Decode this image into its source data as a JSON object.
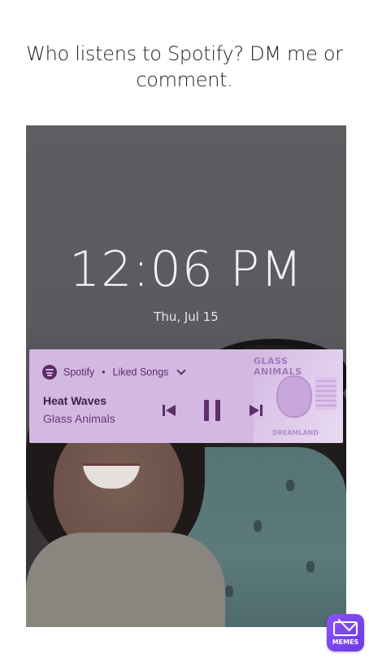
{
  "post": {
    "caption": "Who listens to Spotify?  DM me or comment."
  },
  "lockscreen": {
    "time": "12:06 PM",
    "date": "Thu, Jul 15"
  },
  "media_notification": {
    "app_name": "Spotify",
    "separator": "•",
    "playlist": "Liked Songs",
    "track_title": "Heat Waves",
    "artist": "Glass Animals",
    "album_art_title": "GLASS ANIMALS",
    "album_art_subtitle": "DREAMLAND",
    "card_color": "#d3b8e2",
    "accent_color": "#5d2e6b",
    "icons": {
      "app": "spotify-icon",
      "expand": "chevron-down-icon",
      "previous": "skip-previous-icon",
      "play_pause": "pause-icon",
      "next": "skip-next-icon"
    }
  },
  "watermark": {
    "label": "MEMES",
    "color": "#7a46f0"
  }
}
